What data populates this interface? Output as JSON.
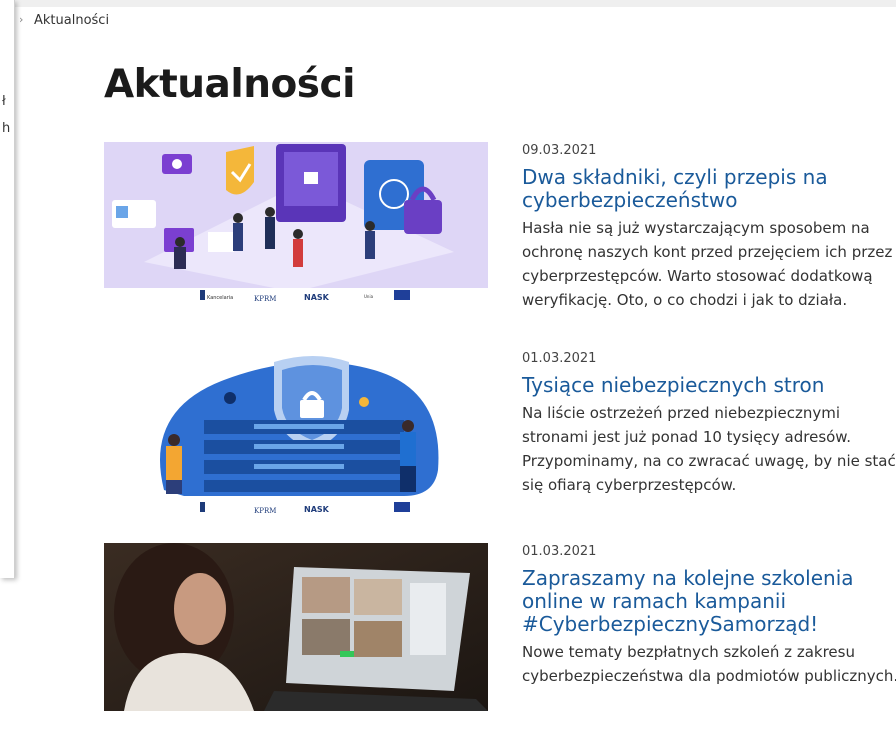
{
  "breadcrumb": {
    "separator": "›",
    "current": "Aktualności"
  },
  "side_panel_fragments": [
    "ł",
    "h"
  ],
  "page_title": "Aktualności",
  "colors": {
    "link": "#1a5a9a",
    "title": "#1b1b1b",
    "accent_purple": "#7b3fd1",
    "accent_blue": "#1f6fd1"
  },
  "news": [
    {
      "date": "09.03.2021",
      "title": "Dwa składniki, czyli przepis na cyberbezpieczeństwo",
      "excerpt": "Hasła nie są już wystarczającym sposobem na ochronę naszych kont przed przejęciem ich przez cyberprzestępców. Warto stosować dodatkową weryfikację. Oto, o co chodzi i jak to działa.",
      "image": "isometric-security-illustration",
      "logos": [
        "KPRM",
        "NASK"
      ]
    },
    {
      "date": "01.03.2021",
      "title": "Tysiące niebezpiecznych stron",
      "excerpt": "Na liście ostrzeżeń przed niebezpiecznymi stronami jest już ponad 10 tysięcy adresów. Przypominamy, na co zwracać uwagę, by nie stać się ofiarą cyberprzestępców.",
      "image": "shield-servers-illustration",
      "logos": [
        "KPRM",
        "NASK"
      ]
    },
    {
      "date": "01.03.2021",
      "title": "Zapraszamy na kolejne szkolenia online w ramach kampanii #CyberbezpiecznySamorząd!",
      "excerpt": "Nowe tematy bezpłatnych szkoleń z zakresu cyberbezpieczeństwa dla podmiotów publicznych.",
      "image": "video-call-photo",
      "logos": []
    }
  ]
}
